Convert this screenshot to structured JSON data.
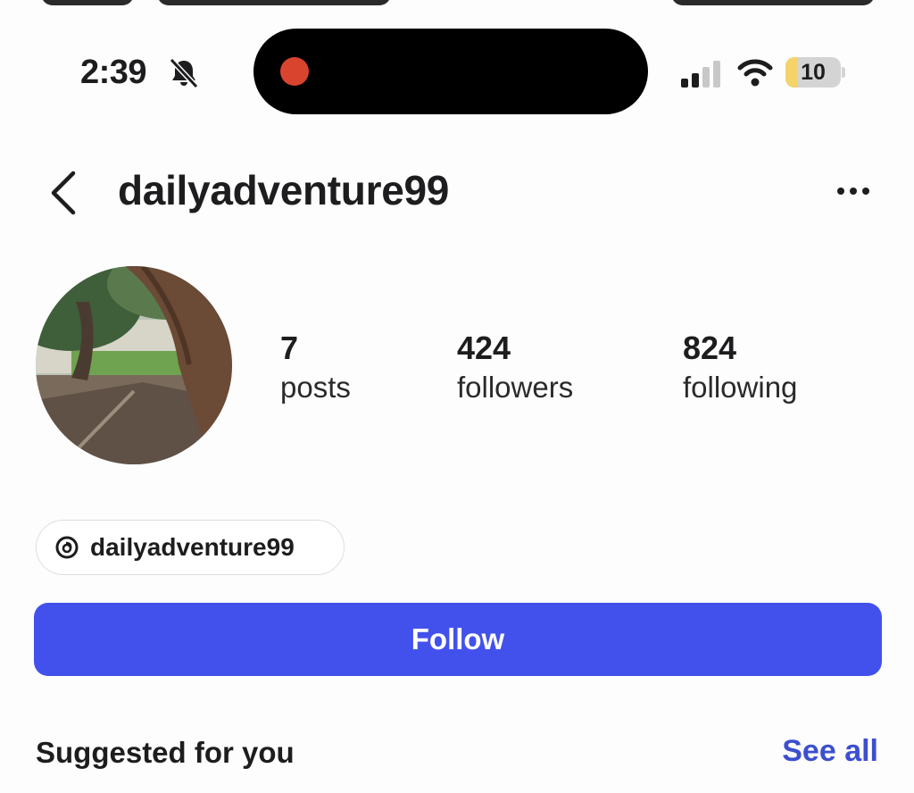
{
  "status_bar": {
    "time": "2:39",
    "battery_level": "10",
    "battery_fraction": 0.1,
    "icons": [
      "bell-muted-icon",
      "signal-icon",
      "wifi-icon",
      "battery-icon"
    ]
  },
  "header": {
    "username": "dailyadventure99",
    "back_icon": "chevron-left-icon",
    "more_icon": "ellipsis-icon"
  },
  "profile": {
    "stats": [
      {
        "value": "7",
        "label": "posts"
      },
      {
        "value": "424",
        "label": "followers"
      },
      {
        "value": "824",
        "label": "following"
      }
    ],
    "threads_handle": "dailyadventure99",
    "threads_icon": "threads-icon"
  },
  "actions": {
    "follow_label": "Follow"
  },
  "suggested": {
    "title": "Suggested for you",
    "see_all_label": "See all"
  },
  "colors": {
    "follow_button": "#4351ec",
    "link": "#3c4fcf",
    "recording_dot": "#d9442f",
    "battery_low": "#f4d36a"
  }
}
